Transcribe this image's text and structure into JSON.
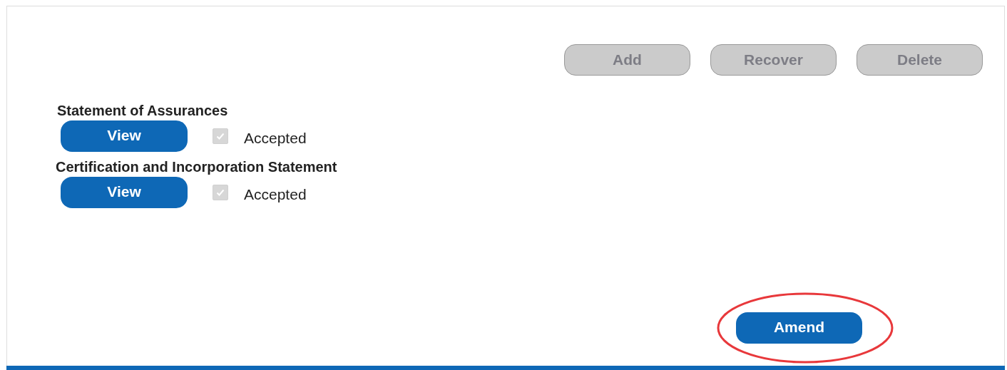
{
  "toolbar": [
    {
      "label": "Add",
      "disabled": true
    },
    {
      "label": "Recover",
      "disabled": true
    },
    {
      "label": "Delete",
      "disabled": true
    }
  ],
  "statements": [
    {
      "title": "Statement of Assurances",
      "button": "View",
      "checkbox": {
        "label": "Accepted",
        "checked": true,
        "disabled": true
      }
    },
    {
      "title": "Certification and Incorporation Statement",
      "button": "View",
      "checkbox": {
        "label": "Accepted",
        "checked": true,
        "disabled": true
      }
    }
  ],
  "footer": {
    "button": "Amend",
    "circled": true
  }
}
